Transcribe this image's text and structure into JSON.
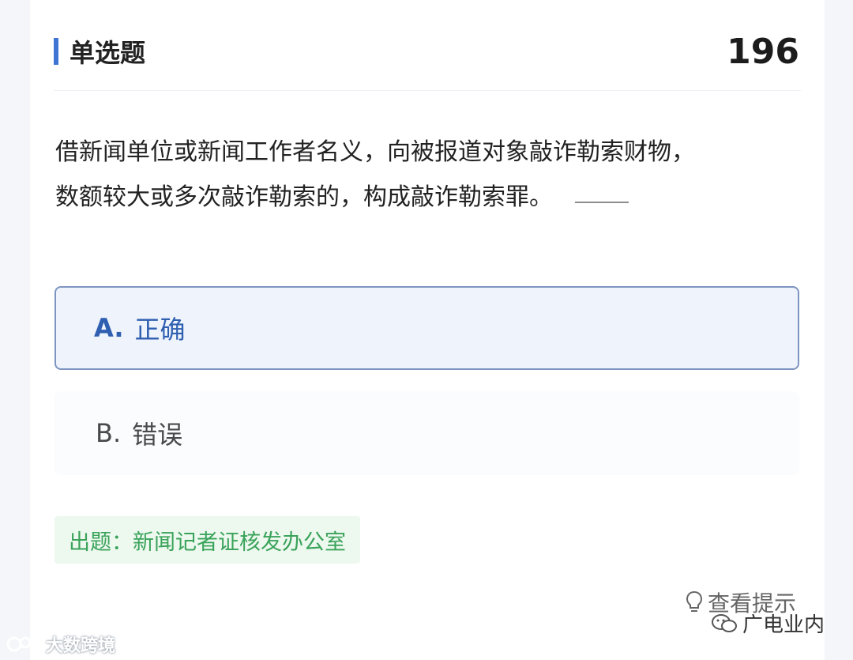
{
  "header": {
    "section_title": "单选题",
    "question_number": "196"
  },
  "question": {
    "line1": "借新闻单位或新闻工作者名义，向被报道对象敲诈勒索财物，",
    "line2": "数额较大或多次敲诈勒索的，构成敲诈勒索罪。"
  },
  "options": [
    {
      "letter": "A.",
      "text": "正确",
      "selected": true
    },
    {
      "letter": "B.",
      "text": "错误",
      "selected": false
    }
  ],
  "source": "出题：新闻记者证核发办公室",
  "hint_label": "查看提示",
  "watermarks": {
    "left": "大数跨境",
    "right": "广电业内"
  },
  "colors": {
    "accent": "#3f74d4",
    "selected_border": "#7e95c2",
    "selected_bg": "#eef3fc",
    "source_text": "#3aa35a",
    "source_bg": "#edf8ef"
  },
  "icons": [
    "lightbulb-icon",
    "wechat-icon",
    "watermark-logo-icon"
  ]
}
